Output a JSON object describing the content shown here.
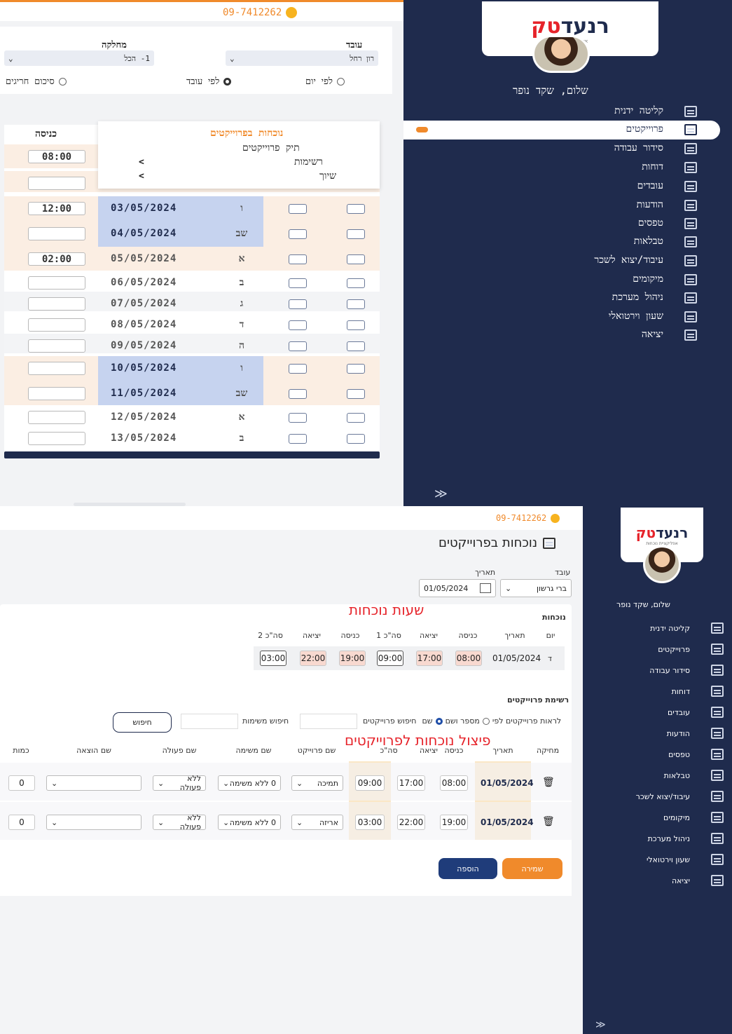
{
  "top": {
    "phone": "09-7412262",
    "filters": {
      "employee_label": "עובד",
      "employee_value": "רון רחל",
      "dept_label": "מחלקה",
      "dept_value": "1- הכל",
      "radio_by_day": "לפי יום",
      "radio_by_employee": "לפי עובד",
      "radio_exceptions": "סיכום חריגים"
    },
    "col_entry": "כניסה",
    "dropdown": {
      "title": "נוכחות בפרוייקטים",
      "items": [
        "תיק פרוייקטים",
        "רשימות",
        "שיוך"
      ],
      "arrow": "<"
    },
    "rows": [
      {
        "date": "",
        "day": "",
        "entry": "08:00"
      },
      {
        "date": "",
        "day": "",
        "entry": ""
      },
      {
        "date": "03/05/2024",
        "day": "ו",
        "entry": "12:00"
      },
      {
        "date": "04/05/2024",
        "day": "שב",
        "entry": ""
      },
      {
        "date": "05/05/2024",
        "day": "א",
        "entry": "02:00"
      },
      {
        "date": "06/05/2024",
        "day": "ב",
        "entry": ""
      },
      {
        "date": "07/05/2024",
        "day": "ג",
        "entry": ""
      },
      {
        "date": "08/05/2024",
        "day": "ד",
        "entry": ""
      },
      {
        "date": "09/05/2024",
        "day": "ה",
        "entry": ""
      },
      {
        "date": "10/05/2024",
        "day": "ו",
        "entry": ""
      },
      {
        "date": "11/05/2024",
        "day": "שב",
        "entry": ""
      },
      {
        "date": "12/05/2024",
        "day": "א",
        "entry": ""
      },
      {
        "date": "13/05/2024",
        "day": "ב",
        "entry": ""
      }
    ],
    "sidebar": {
      "greeting": "שלום, שקד נופר",
      "items": [
        "קליטה ידנית",
        "פרוייקטים",
        "סידור עבודה",
        "דוחות",
        "עובדים",
        "הודעות",
        "טפסים",
        "טבלאות",
        "עיבוד/יצוא לשכר",
        "מיקומים",
        "ניהול מערכת",
        "שעון וירטואלי",
        "יציאה"
      ],
      "collapse": "≫"
    }
  },
  "bottom": {
    "phone": "09-7412262",
    "page_title": "נוכחות בפרוייקטים",
    "employee_label": "עובד",
    "employee_value": "ברי גרשון",
    "date_label": "תאריך",
    "date_value": "01/05/2024",
    "annotation_hours": "שעות נוכחות",
    "annotation_split": "פיצול נוכחות לפרוייקטים",
    "att": {
      "section_label": "נוכחות",
      "headers": [
        "יום",
        "תאריך",
        "כניסה",
        "יציאה",
        "סה\"כ 1",
        "כניסה",
        "יציאה",
        "סה\"כ 2"
      ],
      "row": [
        "ד",
        "01/05/2024",
        "08:00",
        "17:00",
        "09:00",
        "19:00",
        "22:00",
        "03:00"
      ]
    },
    "projects": {
      "section_label": "רשימת פרוייקטים",
      "show_by": "לראות פרוייקטים לפי",
      "opt_number_name": "מספר ושם",
      "opt_name": "שם",
      "search_projects_label": "חיפוש פרוייקטים",
      "search_tasks_label": "חיפוש משימות",
      "search_button": "חיפוש",
      "headers": [
        "מחיקה",
        "תאריך",
        "כניסה",
        "יציאה",
        "סה\"כ",
        "שם פרוייקט",
        "שם משימה",
        "שם פעולה",
        "שם הוצאה",
        "כמות"
      ],
      "rows": [
        {
          "date": "01/05/2024",
          "in": "08:00",
          "out": "17:00",
          "total": "09:00",
          "project": "תמיכה",
          "task": "0 ללא משימה",
          "action": "ללא פעולה",
          "expense": "",
          "qty": "0"
        },
        {
          "date": "01/05/2024",
          "in": "19:00",
          "out": "22:00",
          "total": "03:00",
          "project": "אריזה",
          "task": "0 ללא משימה",
          "action": "ללא פעולה",
          "expense": "",
          "qty": "0"
        }
      ],
      "save_button": "שמירה",
      "add_button": "הוספה"
    },
    "sidebar": {
      "greeting": "שלום, שקד נופר",
      "items": [
        "קליטה ידנית",
        "פרוייקטים",
        "סידור עבודה",
        "דוחות",
        "עובדים",
        "הודעות",
        "טפסים",
        "טבלאות",
        "עיבוד/יצוא לשכר",
        "מיקומים",
        "ניהול מערכת",
        "שעון וירטואלי",
        "יציאה"
      ],
      "collapse": "≫"
    },
    "logo_main": "רנעד",
    "logo_accent": "טק",
    "logo_sub": "אפליקציית נוכחות"
  },
  "colors": {
    "navy": "#1f2b4d",
    "orange": "#f08a2b",
    "peach": "#fbeee3",
    "blue_row": "#c6d3ef",
    "annotation_red": "#e6232a"
  }
}
